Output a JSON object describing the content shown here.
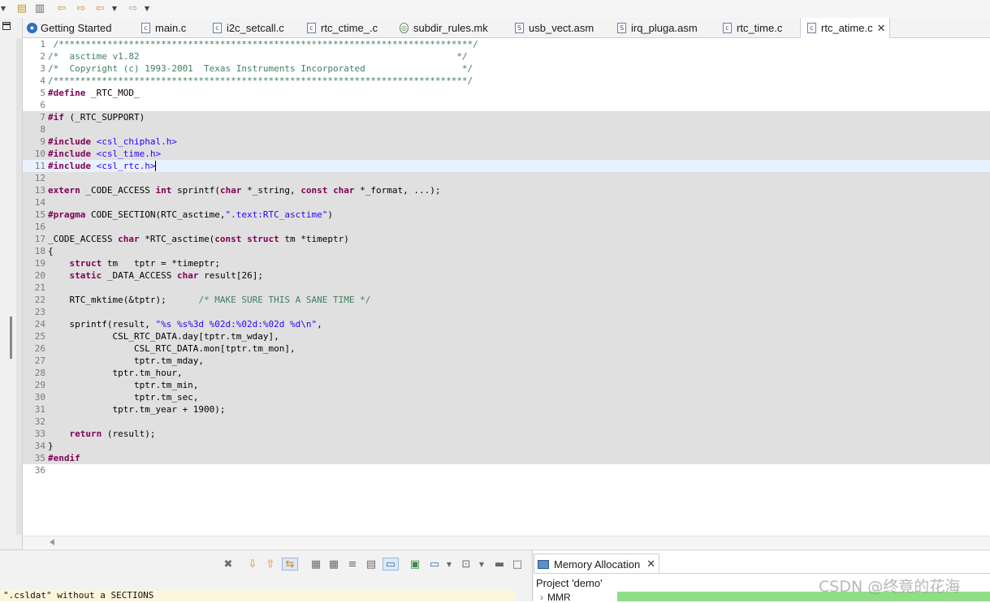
{
  "toolbar": {
    "icons": [
      "chevron-down-icon",
      "save-all-icon",
      "document-icon",
      "prev-edit-icon",
      "next-edit-icon",
      "back-icon",
      "chevron-down-icon",
      "forward-icon",
      "chevron-down-icon"
    ]
  },
  "tabs": [
    {
      "label": "Getting Started",
      "icon": "getting-started-icon"
    },
    {
      "label": "main.c",
      "icon": "c-file-icon"
    },
    {
      "label": "i2c_setcall.c",
      "icon": "c-file-icon"
    },
    {
      "label": "rtc_ctime_.c",
      "icon": "c-file-icon"
    },
    {
      "label": "subdir_rules.mk",
      "icon": "makefile-icon"
    },
    {
      "label": "usb_vect.asm",
      "icon": "asm-file-icon"
    },
    {
      "label": "irq_pluga.asm",
      "icon": "asm-file-icon"
    },
    {
      "label": "rtc_time.c",
      "icon": "c-file-icon"
    },
    {
      "label": "rtc_atime.c",
      "icon": "c-file-icon",
      "active": true
    }
  ],
  "editor": {
    "line_numbers": [
      "1",
      "2",
      "3",
      "4",
      "5",
      "6",
      "7",
      "8",
      "9",
      "10",
      "11",
      "12",
      "13",
      "14",
      "15",
      "16",
      "17",
      "18",
      "19",
      "20",
      "21",
      "22",
      "23",
      "24",
      "25",
      "26",
      "27",
      "28",
      "29",
      "30",
      "31",
      "32",
      "33",
      "34",
      "35",
      "36"
    ],
    "lines": [
      " /*****************************************************************************/",
      "/*  asctime v1.82                                                           */",
      "/*  Copyright (c) 1993-2001  Texas Instruments Incorporated                  */",
      "/*****************************************************************************/",
      "#define _RTC_MOD_",
      "",
      "#if (_RTC_SUPPORT)",
      "",
      "#include <csl_chiphal.h>",
      "#include <csl_time.h>",
      "#include <csl_rtc.h>",
      "",
      "extern _CODE_ACCESS int sprintf(char *_string, const char *_format, ...);",
      "",
      "#pragma CODE_SECTION(RTC_asctime,\".text:RTC_asctime\")",
      "",
      "_CODE_ACCESS char *RTC_asctime(const struct tm *timeptr)",
      "{",
      "    struct tm   tptr = *timeptr;",
      "    static _DATA_ACCESS char result[26];",
      "",
      "    RTC_mktime(&tptr);      /* MAKE SURE THIS A SANE TIME */",
      "",
      "    sprintf(result, \"%s %s%3d %02d:%02d:%02d %d\\n\",",
      "            CSL_RTC_DATA.day[tptr.tm_wday],",
      "                CSL_RTC_DATA.mon[tptr.tm_mon],",
      "                tptr.tm_mday,",
      "            tptr.tm_hour,",
      "                tptr.tm_min,",
      "                tptr.tm_sec,",
      "            tptr.tm_year + 1900);",
      "",
      "    return (result);",
      "}",
      "#endif",
      ""
    ]
  },
  "bottom_toolbar": {
    "icons": [
      "remove-all-icon",
      "next-icon",
      "previous-icon",
      "link-icon",
      "layout-icon",
      "layout2-icon",
      "collapse-icon",
      "filter-icon",
      "details-icon",
      "open-icon",
      "display-icon",
      "chevron-down-icon",
      "pin-icon",
      "chevron-down-icon",
      "minimize-icon",
      "maximize-icon"
    ]
  },
  "console": {
    "text": "\".csldat\" without a SECTIONS"
  },
  "memory_allocation": {
    "tab_label": "Memory Allocation",
    "project_label": "Project 'demo'",
    "row_label": "MMR",
    "accent": "#8fde86"
  },
  "watermark": "CSDN @终竟的花海"
}
